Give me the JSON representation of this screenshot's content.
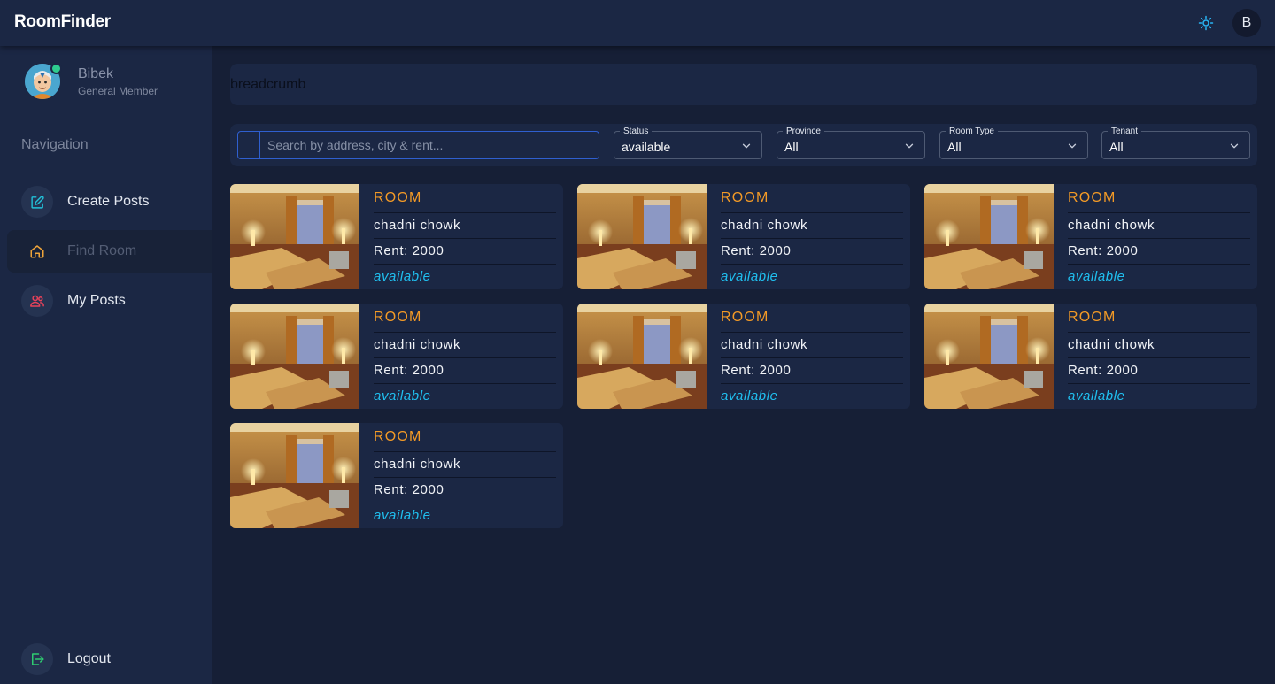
{
  "app": {
    "title": "RoomFinder",
    "avatar_initial": "B"
  },
  "icons": {
    "theme": "sun-icon",
    "create": "edit-icon",
    "find": "home-icon",
    "posts": "users-icon",
    "logout": "logout-icon",
    "chevron": "chevron-down-icon"
  },
  "colors": {
    "accent_orange": "#f39a26",
    "status_blue": "#20c0f0",
    "online": "#2ecc8f",
    "background": "#161f36",
    "panel": "#1b2744"
  },
  "user": {
    "name": "Bibek",
    "role": "General Member"
  },
  "sidebar": {
    "heading": "Navigation",
    "items": [
      {
        "label": "Create Posts",
        "active": false
      },
      {
        "label": "Find Room",
        "active": true
      },
      {
        "label": "My Posts",
        "active": false
      }
    ],
    "logout": "Logout"
  },
  "breadcrumb": "breadcrumb",
  "search": {
    "placeholder": "Search by address, city & rent...",
    "value": ""
  },
  "filters": [
    {
      "label": "Status",
      "value": "available"
    },
    {
      "label": "Province",
      "value": "All"
    },
    {
      "label": "Room Type",
      "value": "All"
    },
    {
      "label": "Tenant",
      "value": "All"
    }
  ],
  "rooms": [
    {
      "type": "ROOM",
      "address": "chadni chowk",
      "rent": "Rent: 2000",
      "status": "available"
    },
    {
      "type": "ROOM",
      "address": "chadni chowk",
      "rent": "Rent: 2000",
      "status": "available"
    },
    {
      "type": "ROOM",
      "address": "chadni chowk",
      "rent": "Rent: 2000",
      "status": "available"
    },
    {
      "type": "ROOM",
      "address": "chadni chowk",
      "rent": "Rent: 2000",
      "status": "available"
    },
    {
      "type": "ROOM",
      "address": "chadni chowk",
      "rent": "Rent: 2000",
      "status": "available"
    },
    {
      "type": "ROOM",
      "address": "chadni chowk",
      "rent": "Rent: 2000",
      "status": "available"
    },
    {
      "type": "ROOM",
      "address": "chadni chowk",
      "rent": "Rent: 2000",
      "status": "available"
    }
  ]
}
